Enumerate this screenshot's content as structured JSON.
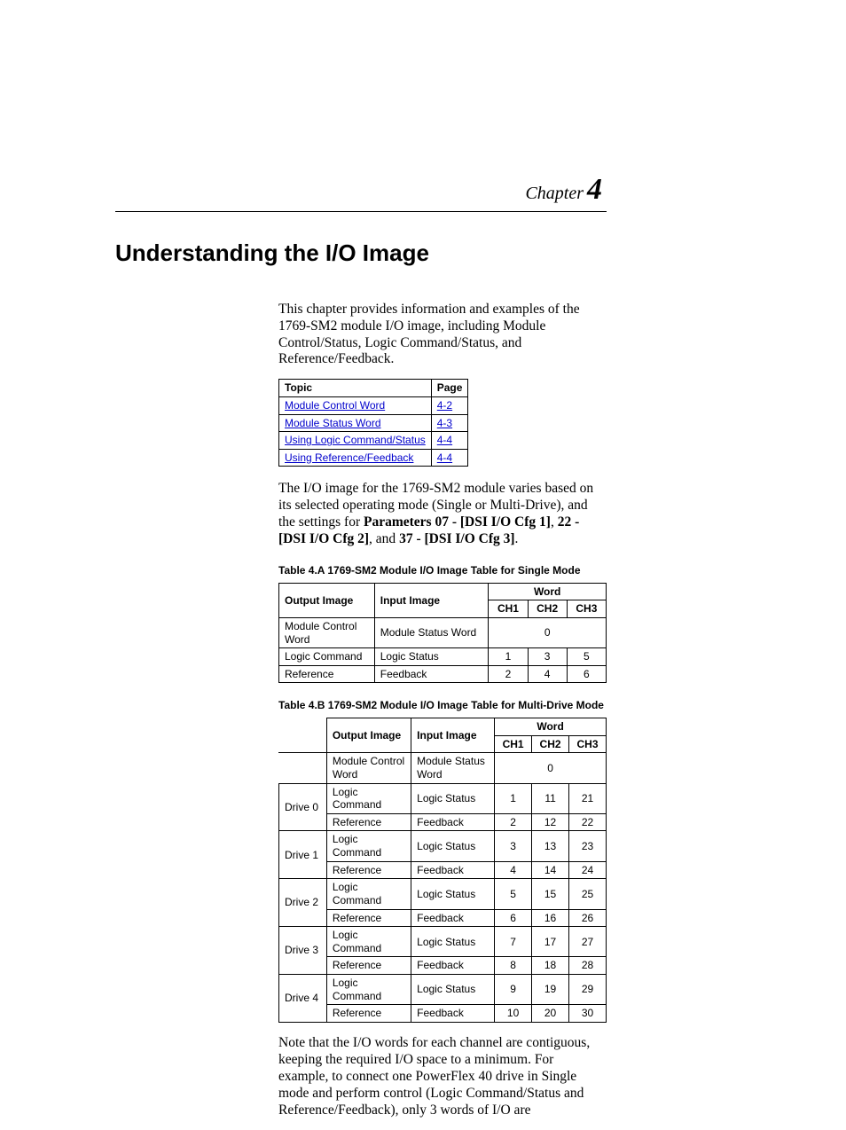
{
  "chapter_label": "Chapter",
  "chapter_num": "4",
  "title": "Understanding the I/O Image",
  "intro": "This chapter provides information and examples of the 1769-SM2 module I/O image, including Module Control/Status, Logic Command/Status, and Reference/Feedback.",
  "topic_header": {
    "topic": "Topic",
    "page": "Page"
  },
  "topics": [
    {
      "label": "Module Control Word",
      "page": "4-2"
    },
    {
      "label": "Module Status Word",
      "page": "4-3"
    },
    {
      "label": "Using Logic Command/Status",
      "page": "4-4"
    },
    {
      "label": "Using Reference/Feedback",
      "page": "4-4"
    }
  ],
  "para2_a": "The I/O image for the 1769-SM2 module varies based on its selected operating mode (Single or Multi-Drive), and the settings for ",
  "para2_b1": "Parameters 07 - [DSI I/O Cfg 1]",
  "para2_c": ", ",
  "para2_b2": "22 - [DSI I/O Cfg 2]",
  "para2_d": ", and ",
  "para2_b3": "37 - [DSI I/O Cfg 3]",
  "para2_e": ".",
  "tableA_caption": "Table 4.A   1769-SM2 Module I/O Image Table for Single Mode",
  "tableA": {
    "headers": {
      "out": "Output Image",
      "in": "Input Image",
      "word": "Word",
      "ch1": "CH1",
      "ch2": "CH2",
      "ch3": "CH3"
    },
    "rows": [
      {
        "out": "Module Control Word",
        "in": "Module Status Word",
        "span": "0"
      },
      {
        "out": "Logic Command",
        "in": "Logic Status",
        "ch1": "1",
        "ch2": "3",
        "ch3": "5"
      },
      {
        "out": "Reference",
        "in": "Feedback",
        "ch1": "2",
        "ch2": "4",
        "ch3": "6"
      }
    ]
  },
  "tableB_caption": "Table 4.B   1769-SM2 Module I/O Image Table for Multi-Drive Mode",
  "tableB": {
    "headers": {
      "out": "Output Image",
      "in": "Input Image",
      "word": "Word",
      "ch1": "CH1",
      "ch2": "CH2",
      "ch3": "CH3"
    },
    "module_row": {
      "out": "Module Control Word",
      "in": "Module Status Word",
      "span": "0"
    },
    "drives": [
      {
        "label": "Drive 0",
        "rows": [
          {
            "out": "Logic Command",
            "in": "Logic Status",
            "ch1": "1",
            "ch2": "11",
            "ch3": "21"
          },
          {
            "out": "Reference",
            "in": "Feedback",
            "ch1": "2",
            "ch2": "12",
            "ch3": "22"
          }
        ]
      },
      {
        "label": "Drive 1",
        "rows": [
          {
            "out": "Logic Command",
            "in": "Logic Status",
            "ch1": "3",
            "ch2": "13",
            "ch3": "23"
          },
          {
            "out": "Reference",
            "in": "Feedback",
            "ch1": "4",
            "ch2": "14",
            "ch3": "24"
          }
        ]
      },
      {
        "label": "Drive 2",
        "rows": [
          {
            "out": "Logic Command",
            "in": "Logic Status",
            "ch1": "5",
            "ch2": "15",
            "ch3": "25"
          },
          {
            "out": "Reference",
            "in": "Feedback",
            "ch1": "6",
            "ch2": "16",
            "ch3": "26"
          }
        ]
      },
      {
        "label": "Drive 3",
        "rows": [
          {
            "out": "Logic Command",
            "in": "Logic Status",
            "ch1": "7",
            "ch2": "17",
            "ch3": "27"
          },
          {
            "out": "Reference",
            "in": "Feedback",
            "ch1": "8",
            "ch2": "18",
            "ch3": "28"
          }
        ]
      },
      {
        "label": "Drive 4",
        "rows": [
          {
            "out": "Logic Command",
            "in": "Logic Status",
            "ch1": "9",
            "ch2": "19",
            "ch3": "29"
          },
          {
            "out": "Reference",
            "in": "Feedback",
            "ch1": "10",
            "ch2": "20",
            "ch3": "30"
          }
        ]
      }
    ]
  },
  "para3": "Note that the I/O words for each channel are contiguous, keeping the required I/O space to a minimum. For example, to connect one PowerFlex 40 drive in Single mode and perform control (Logic Command/Status and Reference/Feedback), only 3 words of I/O are"
}
